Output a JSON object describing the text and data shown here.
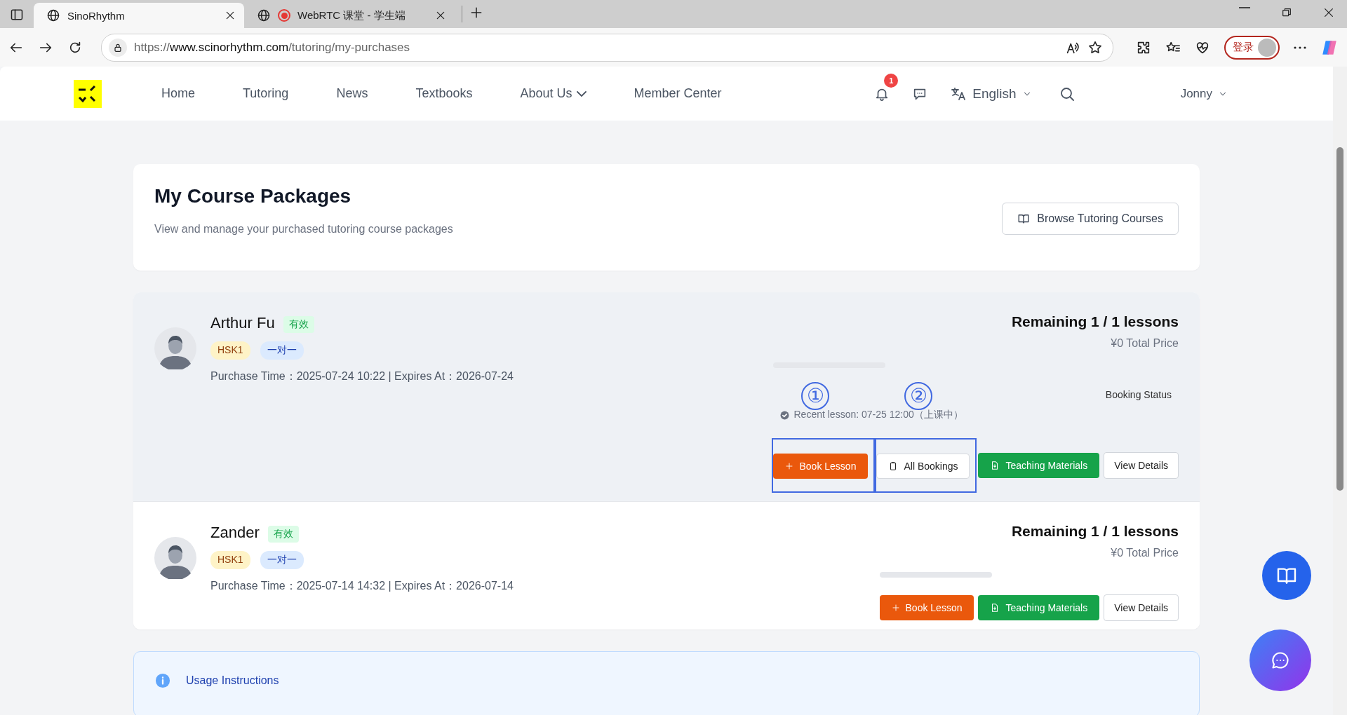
{
  "browser": {
    "tabs": [
      {
        "title": "SinoRhythm",
        "selected": true,
        "recording": false
      },
      {
        "title": "WebRTC 课堂 - 学生端",
        "selected": false,
        "recording": true
      }
    ],
    "url": {
      "scheme": "https://",
      "host": "www.scinorhythm.com",
      "path": "/tutoring/my-purchases"
    },
    "profile_button": "登录"
  },
  "nav": {
    "items": [
      {
        "label": "Home",
        "dropdown": false
      },
      {
        "label": "Tutoring",
        "dropdown": false
      },
      {
        "label": "News",
        "dropdown": false
      },
      {
        "label": "Textbooks",
        "dropdown": false
      },
      {
        "label": "About Us",
        "dropdown": true
      },
      {
        "label": "Member Center",
        "dropdown": false
      }
    ],
    "notification_count": "1",
    "language": "English",
    "user": "Jonny"
  },
  "header": {
    "title": "My Course Packages",
    "subtitle": "View and manage your purchased tutoring course packages",
    "browse_button": "Browse Tutoring Courses"
  },
  "packages": [
    {
      "teacher": "Arthur Fu",
      "status": "有效",
      "highlighted": true,
      "tags": [
        {
          "label": "HSK1",
          "kind": "level"
        },
        {
          "label": "一对一",
          "kind": "type"
        }
      ],
      "purchase": "Purchase Time：2025-07-24 10:22 | Expires At：2026-07-24",
      "remaining": "Remaining 1 / 1 lessons",
      "price": "¥0 Total Price",
      "booking_status": "Booking Status",
      "recent_lesson": "Recent lesson: 07-25 12:00（上课中）",
      "actions": [
        {
          "kind": "primary",
          "label": "Book Lesson",
          "annotation": "①"
        },
        {
          "kind": "outline",
          "label": "All Bookings",
          "annotation": "②"
        },
        {
          "kind": "success",
          "label": "Teaching Materials"
        },
        {
          "kind": "plain",
          "label": "View Details"
        }
      ]
    },
    {
      "teacher": "Zander",
      "status": "有效",
      "highlighted": false,
      "tags": [
        {
          "label": "HSK1",
          "kind": "level"
        },
        {
          "label": "一对一",
          "kind": "type"
        }
      ],
      "purchase": "Purchase Time：2025-07-14 14:32 | Expires At：2026-07-14",
      "remaining": "Remaining 1 / 1 lessons",
      "price": "¥0 Total Price",
      "actions": [
        {
          "kind": "primary",
          "label": "Book Lesson"
        },
        {
          "kind": "success",
          "label": "Teaching Materials"
        },
        {
          "kind": "plain",
          "label": "View Details"
        }
      ]
    }
  ],
  "usage": {
    "title": "Usage Instructions"
  }
}
